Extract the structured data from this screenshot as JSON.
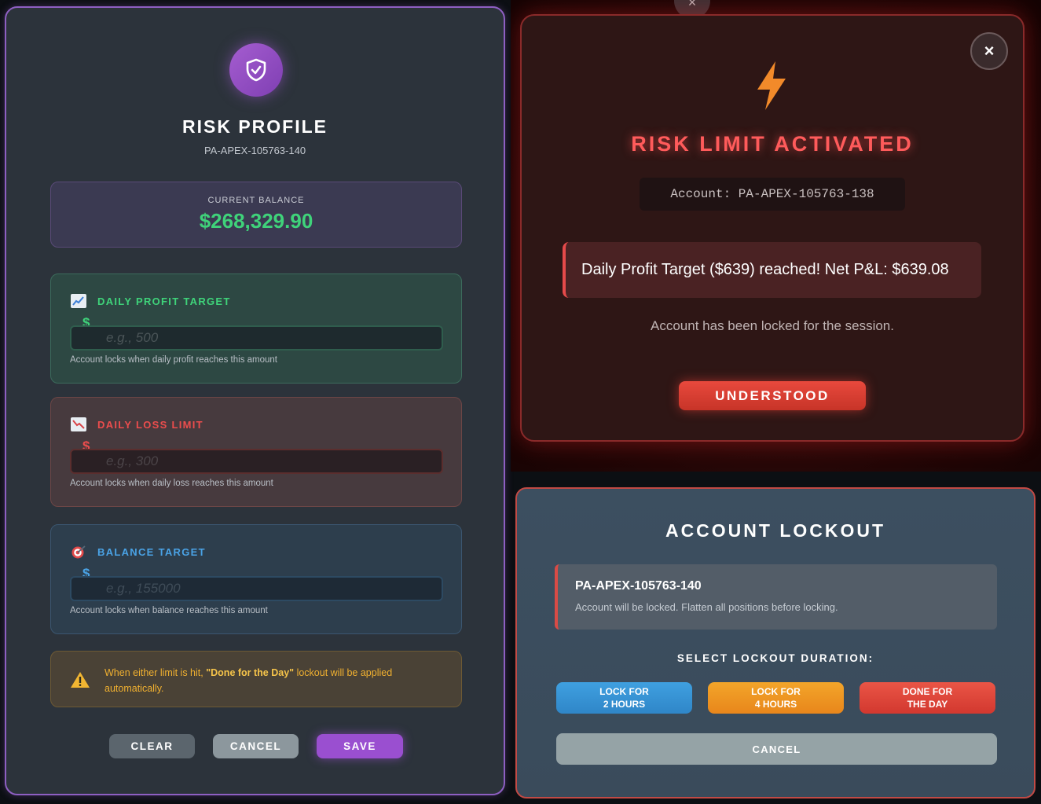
{
  "risk_profile": {
    "title": "RISK PROFILE",
    "account_id": "PA-APEX-105763-140",
    "balance": {
      "label": "CURRENT BALANCE",
      "value": "$268,329.90"
    },
    "daily_profit": {
      "title": "DAILY PROFIT TARGET",
      "currency": "$",
      "placeholder": "e.g., 500",
      "help": "Account locks when daily profit reaches this amount"
    },
    "daily_loss": {
      "title": "DAILY LOSS LIMIT",
      "currency": "$",
      "placeholder": "e.g., 300",
      "help": "Account locks when daily loss reaches this amount"
    },
    "balance_target": {
      "title": "BALANCE TARGET",
      "currency": "$",
      "placeholder": "e.g., 155000",
      "help": "Account locks when balance reaches this amount"
    },
    "warning": {
      "prefix": "When either limit is hit, ",
      "highlight": "\"Done for the Day\"",
      "suffix": " lockout will be applied automatically."
    },
    "buttons": {
      "clear": "CLEAR",
      "cancel": "CANCEL",
      "save": "SAVE"
    }
  },
  "risk_alert": {
    "ghost_close": "×",
    "close": "×",
    "title": "RISK LIMIT ACTIVATED",
    "account": "Account: PA-APEX-105763-138",
    "message": "Daily Profit Target ($639) reached! Net P&L: $639.08",
    "locked_note": "Account has been locked for the session.",
    "button": "UNDERSTOOD"
  },
  "lockout": {
    "title": "ACCOUNT LOCKOUT",
    "account_id": "PA-APEX-105763-140",
    "note": "Account will be locked. Flatten all positions before locking.",
    "select_label": "SELECT LOCKOUT DURATION:",
    "options": [
      {
        "line1": "LOCK FOR",
        "line2": "2 HOURS"
      },
      {
        "line1": "LOCK FOR",
        "line2": "4 HOURS"
      },
      {
        "line1": "DONE FOR",
        "line2": "THE DAY"
      }
    ],
    "cancel": "CANCEL"
  }
}
